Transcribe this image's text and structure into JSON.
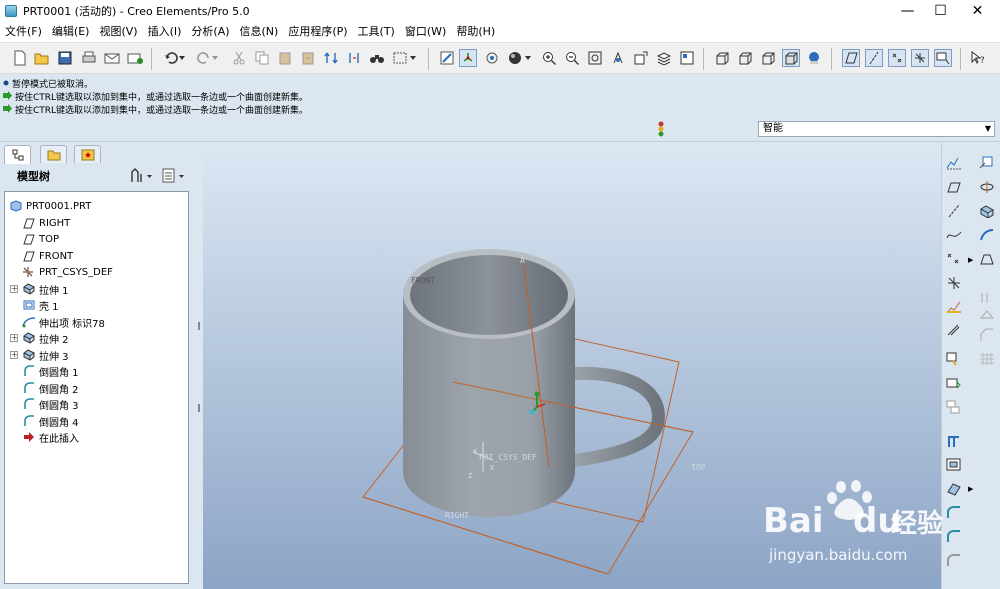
{
  "window": {
    "title": "PRT0001 (活动的) - Creo Elements/Pro 5.0",
    "minimize": "—",
    "maximize": "☐",
    "close": "✕"
  },
  "menu": [
    "文件(F)",
    "编辑(E)",
    "视图(V)",
    "插入(I)",
    "分析(A)",
    "信息(N)",
    "应用程序(P)",
    "工具(T)",
    "窗口(W)",
    "帮助(H)"
  ],
  "messages": [
    "暂停模式已被取消。",
    "按住CTRL键选取以添加到集中，或通过选取一条边或一个曲面创建新集。",
    "按住CTRL键选取以添加到集中，或通过选取一条边或一个曲面创建新集。"
  ],
  "filter": {
    "selected": "智能"
  },
  "model_tree": {
    "title": "模型树",
    "items": [
      {
        "label": "PRT0001.PRT",
        "icon": "part-icon",
        "expandable": false
      },
      {
        "label": "RIGHT",
        "icon": "datum-plane-icon",
        "expandable": false
      },
      {
        "label": "TOP",
        "icon": "datum-plane-icon",
        "expandable": false
      },
      {
        "label": "FRONT",
        "icon": "datum-plane-icon",
        "expandable": false
      },
      {
        "label": "PRT_CSYS_DEF",
        "icon": "csys-icon",
        "expandable": false
      },
      {
        "label": "拉伸 1",
        "icon": "extrude-icon",
        "expandable": true
      },
      {
        "label": "壳 1",
        "icon": "shell-icon",
        "expandable": false
      },
      {
        "label": "伸出项 标识78",
        "icon": "sweep-icon",
        "expandable": false
      },
      {
        "label": "拉伸 2",
        "icon": "extrude-icon",
        "expandable": true
      },
      {
        "label": "拉伸 3",
        "icon": "extrude-icon",
        "expandable": true
      },
      {
        "label": "倒圆角 1",
        "icon": "round-icon",
        "expandable": false
      },
      {
        "label": "倒圆角 2",
        "icon": "round-icon",
        "expandable": false
      },
      {
        "label": "倒圆角 3",
        "icon": "round-icon",
        "expandable": false
      },
      {
        "label": "倒圆角 4",
        "icon": "round-icon",
        "expandable": false
      },
      {
        "label": "在此插入",
        "icon": "insert-here-icon",
        "expandable": false
      }
    ]
  },
  "viewport": {
    "datum_labels": {
      "front": "FRONT",
      "top": "TOP",
      "right": "RIGHT",
      "csys": "PRT_CSYS_DEF",
      "axis_a": "A",
      "axis_x": "X",
      "axis_y": "Y",
      "axis_z": "Z"
    }
  },
  "watermark": {
    "brand": "Bai",
    "brand_tail": "du",
    "suffix": "经验",
    "url": "jingyan.baidu.com"
  },
  "colors": {
    "panel_bg": "#dbe6f1",
    "datum_line": "#c0622a",
    "model_gray": "#9aa1a8",
    "accent_blue": "#2a6ebb"
  }
}
